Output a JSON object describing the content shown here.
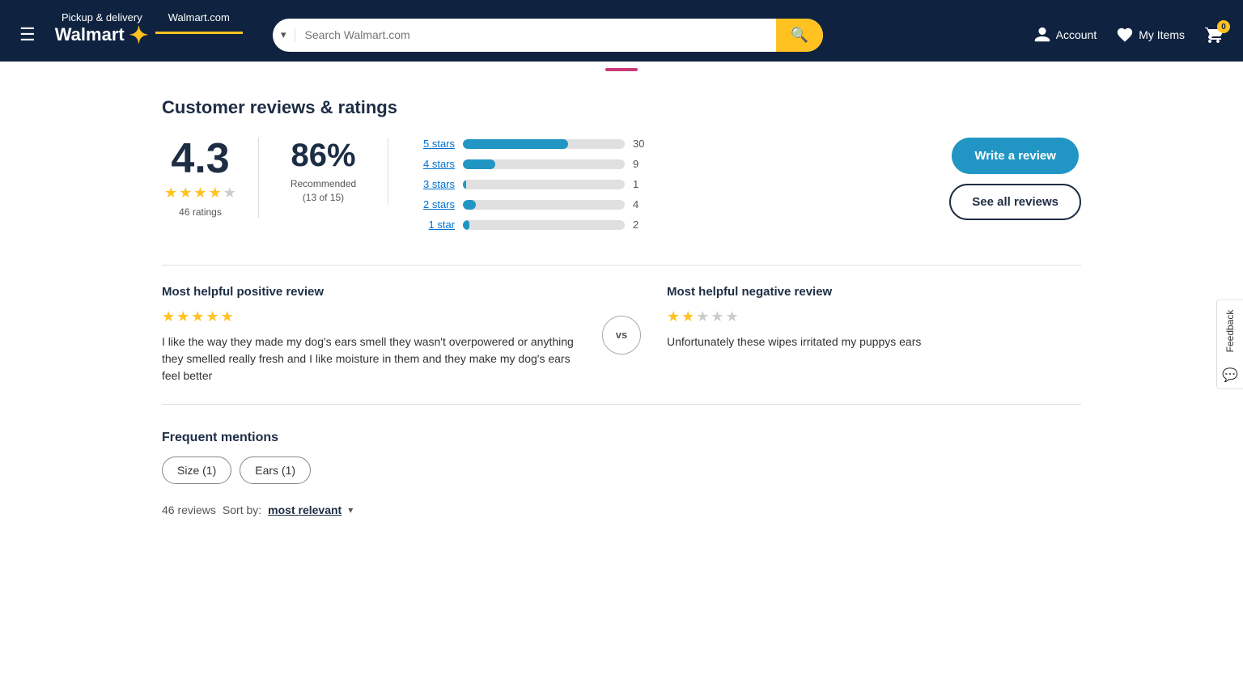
{
  "header": {
    "tabs": [
      {
        "label": "Pickup & delivery",
        "active": false
      },
      {
        "label": "Walmart.com",
        "active": true
      }
    ],
    "logo_text": "Walmart",
    "search_placeholder": "Search Walmart.com",
    "account_label": "Account",
    "myitems_label": "My Items",
    "cart_count": "0"
  },
  "pink_divider": true,
  "reviews": {
    "section_title": "Customer reviews & ratings",
    "overall_score": "4.3",
    "stars": [
      true,
      true,
      true,
      true,
      false
    ],
    "rating_count": "46 ratings",
    "recommended_percent": "86%",
    "recommended_text": "Recommended\n(13 of 15)",
    "bar_rows": [
      {
        "label": "5 stars",
        "fill_pct": 65,
        "count": "30"
      },
      {
        "label": "4 stars",
        "fill_pct": 20,
        "count": "9"
      },
      {
        "label": "3 stars",
        "fill_pct": 2,
        "count": "1"
      },
      {
        "label": "2 stars",
        "fill_pct": 8,
        "count": "4"
      },
      {
        "label": "1 star",
        "fill_pct": 4,
        "count": "2"
      }
    ],
    "write_review_label": "Write a review",
    "see_all_reviews_label": "See all reviews",
    "helpful_positive_title": "Most helpful positive review",
    "positive_stars": [
      true,
      true,
      true,
      true,
      true
    ],
    "positive_text": "I like the way they made my dog's ears smell they wasn't overpowered or anything they smelled really fresh and I like moisture in them and they make my dog's ears feel better",
    "vs_label": "vs",
    "helpful_negative_title": "Most helpful negative review",
    "negative_stars": [
      true,
      true,
      false,
      false,
      false
    ],
    "negative_text": "Unfortunately these wipes irritated my puppys ears",
    "frequent_mentions_title": "Frequent mentions",
    "mention_tags": [
      {
        "label": "Size (1)"
      },
      {
        "label": "Ears (1)"
      }
    ],
    "reviews_count": "46 reviews",
    "sort_by_label": "Sort by:",
    "sort_by_value": "most relevant"
  },
  "feedback": {
    "label": "Feedback"
  }
}
